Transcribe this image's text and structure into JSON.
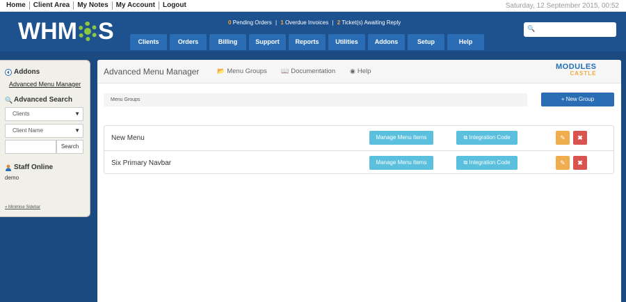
{
  "topbar": {
    "links": [
      "Home",
      "Client Area",
      "My Notes",
      "My Account",
      "Logout"
    ],
    "datetime": "Saturday, 12 September 2015, 00:52"
  },
  "header": {
    "logo_left": "WHM",
    "logo_right": "S",
    "notices": {
      "pending_count": "0",
      "pending_label": "Pending Orders",
      "overdue_count": "1",
      "overdue_label": "Overdue Invoices",
      "tickets_count": "2",
      "tickets_label": "Ticket(s) Awaiting Reply"
    },
    "search_icon": "magnifier-icon",
    "nav": [
      "Clients",
      "Orders",
      "Billing",
      "Support",
      "Reports",
      "Utilities",
      "Addons",
      "Setup",
      "Help"
    ]
  },
  "sidebar": {
    "addons_title": "Addons",
    "addons_link": "Advanced Menu Manager",
    "search_title": "Advanced Search",
    "select1": "Clients",
    "select2": "Client Name",
    "search_button": "Search",
    "staff_title": "Staff Online",
    "staff_user": "demo",
    "minimise": "« Minimise Sidebar"
  },
  "module": {
    "title": "Advanced Menu Manager",
    "nav": {
      "menu_groups": "Menu Groups",
      "documentation": "Documentation",
      "help": "Help"
    },
    "brand_top": "MODULES",
    "brand_bottom": "CASTLE",
    "breadcrumb": "Menu Groups",
    "new_group": "+ New Group",
    "rows": [
      {
        "name": "New Menu",
        "manage": "Manage Menu Items",
        "integration": "Integration Code"
      },
      {
        "name": "Six Primary Navbar",
        "manage": "Manage Menu Items",
        "integration": "Integration Code"
      }
    ]
  },
  "colors": {
    "header_bg": "#1e528e",
    "nav_tab": "#2a6db5",
    "info_button": "#5bc0de",
    "warning_button": "#f0ad4e",
    "danger_button": "#d9534f",
    "notice_highlight": "#f3a93b",
    "logo_gear": "#8cc63f"
  }
}
